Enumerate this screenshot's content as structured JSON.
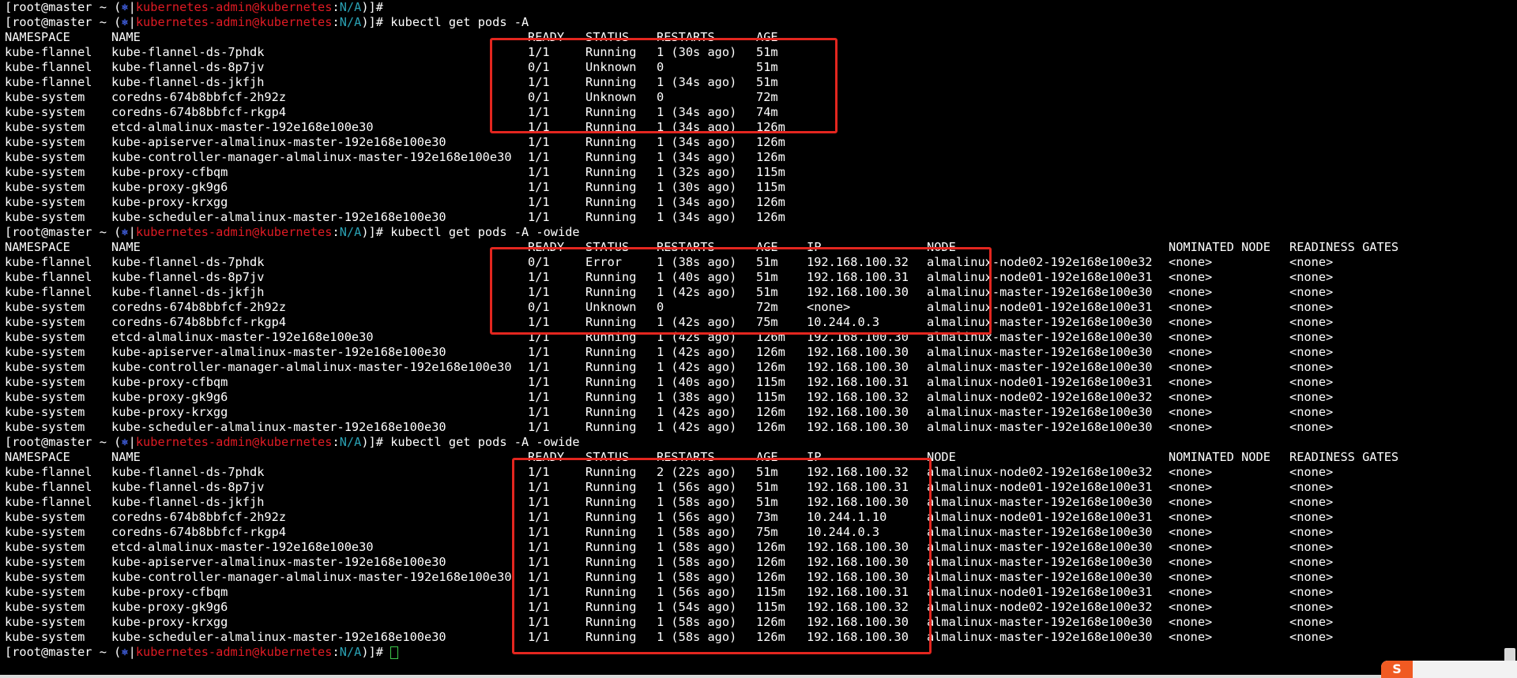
{
  "prompt": {
    "user": "[root@master ~ ",
    "open": "(",
    "symbol": "⎈",
    "sep": "|",
    "context": "kubernetes-admin@kubernetes",
    "ns": "N/A",
    "close": ")]# "
  },
  "commands": [
    "",
    "kubectl get pods -A",
    "kubectl get pods -A -owide",
    "kubectl get pods -A -owide",
    ""
  ],
  "headers": {
    "short": [
      "NAMESPACE",
      "NAME",
      "READY",
      "STATUS",
      "RESTARTS",
      "AGE"
    ],
    "wide": [
      "NAMESPACE",
      "NAME",
      "READY",
      "STATUS",
      "RESTARTS",
      "AGE",
      "IP",
      "NODE",
      "NOMINATED NODE",
      "READINESS GATES"
    ]
  },
  "output1": [
    [
      "kube-flannel",
      "kube-flannel-ds-7phdk",
      "1/1",
      "Running",
      "1 (30s ago)",
      "51m"
    ],
    [
      "kube-flannel",
      "kube-flannel-ds-8p7jv",
      "0/1",
      "Unknown",
      "0",
      "51m"
    ],
    [
      "kube-flannel",
      "kube-flannel-ds-jkfjh",
      "1/1",
      "Running",
      "1 (34s ago)",
      "51m"
    ],
    [
      "kube-system",
      "coredns-674b8bbfcf-2h92z",
      "0/1",
      "Unknown",
      "0",
      "72m"
    ],
    [
      "kube-system",
      "coredns-674b8bbfcf-rkgp4",
      "1/1",
      "Running",
      "1 (34s ago)",
      "74m"
    ],
    [
      "kube-system",
      "etcd-almalinux-master-192e168e100e30",
      "1/1",
      "Running",
      "1 (34s ago)",
      "126m"
    ],
    [
      "kube-system",
      "kube-apiserver-almalinux-master-192e168e100e30",
      "1/1",
      "Running",
      "1 (34s ago)",
      "126m"
    ],
    [
      "kube-system",
      "kube-controller-manager-almalinux-master-192e168e100e30",
      "1/1",
      "Running",
      "1 (34s ago)",
      "126m"
    ],
    [
      "kube-system",
      "kube-proxy-cfbqm",
      "1/1",
      "Running",
      "1 (32s ago)",
      "115m"
    ],
    [
      "kube-system",
      "kube-proxy-gk9g6",
      "1/1",
      "Running",
      "1 (30s ago)",
      "115m"
    ],
    [
      "kube-system",
      "kube-proxy-krxgg",
      "1/1",
      "Running",
      "1 (34s ago)",
      "126m"
    ],
    [
      "kube-system",
      "kube-scheduler-almalinux-master-192e168e100e30",
      "1/1",
      "Running",
      "1 (34s ago)",
      "126m"
    ]
  ],
  "output2": [
    [
      "kube-flannel",
      "kube-flannel-ds-7phdk",
      "0/1",
      "Error",
      "1 (38s ago)",
      "51m",
      "192.168.100.32",
      "almalinux-node02-192e168e100e32",
      "<none>",
      "<none>"
    ],
    [
      "kube-flannel",
      "kube-flannel-ds-8p7jv",
      "1/1",
      "Running",
      "1 (40s ago)",
      "51m",
      "192.168.100.31",
      "almalinux-node01-192e168e100e31",
      "<none>",
      "<none>"
    ],
    [
      "kube-flannel",
      "kube-flannel-ds-jkfjh",
      "1/1",
      "Running",
      "1 (42s ago)",
      "51m",
      "192.168.100.30",
      "almalinux-master-192e168e100e30",
      "<none>",
      "<none>"
    ],
    [
      "kube-system",
      "coredns-674b8bbfcf-2h92z",
      "0/1",
      "Unknown",
      "0",
      "72m",
      "<none>",
      "almalinux-node01-192e168e100e31",
      "<none>",
      "<none>"
    ],
    [
      "kube-system",
      "coredns-674b8bbfcf-rkgp4",
      "1/1",
      "Running",
      "1 (42s ago)",
      "75m",
      "10.244.0.3",
      "almalinux-master-192e168e100e30",
      "<none>",
      "<none>"
    ],
    [
      "kube-system",
      "etcd-almalinux-master-192e168e100e30",
      "1/1",
      "Running",
      "1 (42s ago)",
      "126m",
      "192.168.100.30",
      "almalinux-master-192e168e100e30",
      "<none>",
      "<none>"
    ],
    [
      "kube-system",
      "kube-apiserver-almalinux-master-192e168e100e30",
      "1/1",
      "Running",
      "1 (42s ago)",
      "126m",
      "192.168.100.30",
      "almalinux-master-192e168e100e30",
      "<none>",
      "<none>"
    ],
    [
      "kube-system",
      "kube-controller-manager-almalinux-master-192e168e100e30",
      "1/1",
      "Running",
      "1 (42s ago)",
      "126m",
      "192.168.100.30",
      "almalinux-master-192e168e100e30",
      "<none>",
      "<none>"
    ],
    [
      "kube-system",
      "kube-proxy-cfbqm",
      "1/1",
      "Running",
      "1 (40s ago)",
      "115m",
      "192.168.100.31",
      "almalinux-node01-192e168e100e31",
      "<none>",
      "<none>"
    ],
    [
      "kube-system",
      "kube-proxy-gk9g6",
      "1/1",
      "Running",
      "1 (38s ago)",
      "115m",
      "192.168.100.32",
      "almalinux-node02-192e168e100e32",
      "<none>",
      "<none>"
    ],
    [
      "kube-system",
      "kube-proxy-krxgg",
      "1/1",
      "Running",
      "1 (42s ago)",
      "126m",
      "192.168.100.30",
      "almalinux-master-192e168e100e30",
      "<none>",
      "<none>"
    ],
    [
      "kube-system",
      "kube-scheduler-almalinux-master-192e168e100e30",
      "1/1",
      "Running",
      "1 (42s ago)",
      "126m",
      "192.168.100.30",
      "almalinux-master-192e168e100e30",
      "<none>",
      "<none>"
    ]
  ],
  "output3": [
    [
      "kube-flannel",
      "kube-flannel-ds-7phdk",
      "1/1",
      "Running",
      "2 (22s ago)",
      "51m",
      "192.168.100.32",
      "almalinux-node02-192e168e100e32",
      "<none>",
      "<none>"
    ],
    [
      "kube-flannel",
      "kube-flannel-ds-8p7jv",
      "1/1",
      "Running",
      "1 (56s ago)",
      "51m",
      "192.168.100.31",
      "almalinux-node01-192e168e100e31",
      "<none>",
      "<none>"
    ],
    [
      "kube-flannel",
      "kube-flannel-ds-jkfjh",
      "1/1",
      "Running",
      "1 (58s ago)",
      "51m",
      "192.168.100.30",
      "almalinux-master-192e168e100e30",
      "<none>",
      "<none>"
    ],
    [
      "kube-system",
      "coredns-674b8bbfcf-2h92z",
      "1/1",
      "Running",
      "1 (56s ago)",
      "73m",
      "10.244.1.10",
      "almalinux-node01-192e168e100e31",
      "<none>",
      "<none>"
    ],
    [
      "kube-system",
      "coredns-674b8bbfcf-rkgp4",
      "1/1",
      "Running",
      "1 (58s ago)",
      "75m",
      "10.244.0.3",
      "almalinux-master-192e168e100e30",
      "<none>",
      "<none>"
    ],
    [
      "kube-system",
      "etcd-almalinux-master-192e168e100e30",
      "1/1",
      "Running",
      "1 (58s ago)",
      "126m",
      "192.168.100.30",
      "almalinux-master-192e168e100e30",
      "<none>",
      "<none>"
    ],
    [
      "kube-system",
      "kube-apiserver-almalinux-master-192e168e100e30",
      "1/1",
      "Running",
      "1 (58s ago)",
      "126m",
      "192.168.100.30",
      "almalinux-master-192e168e100e30",
      "<none>",
      "<none>"
    ],
    [
      "kube-system",
      "kube-controller-manager-almalinux-master-192e168e100e30",
      "1/1",
      "Running",
      "1 (58s ago)",
      "126m",
      "192.168.100.30",
      "almalinux-master-192e168e100e30",
      "<none>",
      "<none>"
    ],
    [
      "kube-system",
      "kube-proxy-cfbqm",
      "1/1",
      "Running",
      "1 (56s ago)",
      "115m",
      "192.168.100.31",
      "almalinux-node01-192e168e100e31",
      "<none>",
      "<none>"
    ],
    [
      "kube-system",
      "kube-proxy-gk9g6",
      "1/1",
      "Running",
      "1 (54s ago)",
      "115m",
      "192.168.100.32",
      "almalinux-node02-192e168e100e32",
      "<none>",
      "<none>"
    ],
    [
      "kube-system",
      "kube-proxy-krxgg",
      "1/1",
      "Running",
      "1 (58s ago)",
      "126m",
      "192.168.100.30",
      "almalinux-master-192e168e100e30",
      "<none>",
      "<none>"
    ],
    [
      "kube-system",
      "kube-scheduler-almalinux-master-192e168e100e30",
      "1/1",
      "Running",
      "1 (58s ago)",
      "126m",
      "192.168.100.30",
      "almalinux-master-192e168e100e30",
      "<none>",
      "<none>"
    ]
  ],
  "ime": {
    "logo_text": "S"
  },
  "colors": {
    "background": "#000000",
    "text": "#ffffff",
    "prompt_user": "#e01b24",
    "prompt_context": "#2aa1b3",
    "highlight": "#e3261f",
    "cursor": "#3ec94b"
  }
}
